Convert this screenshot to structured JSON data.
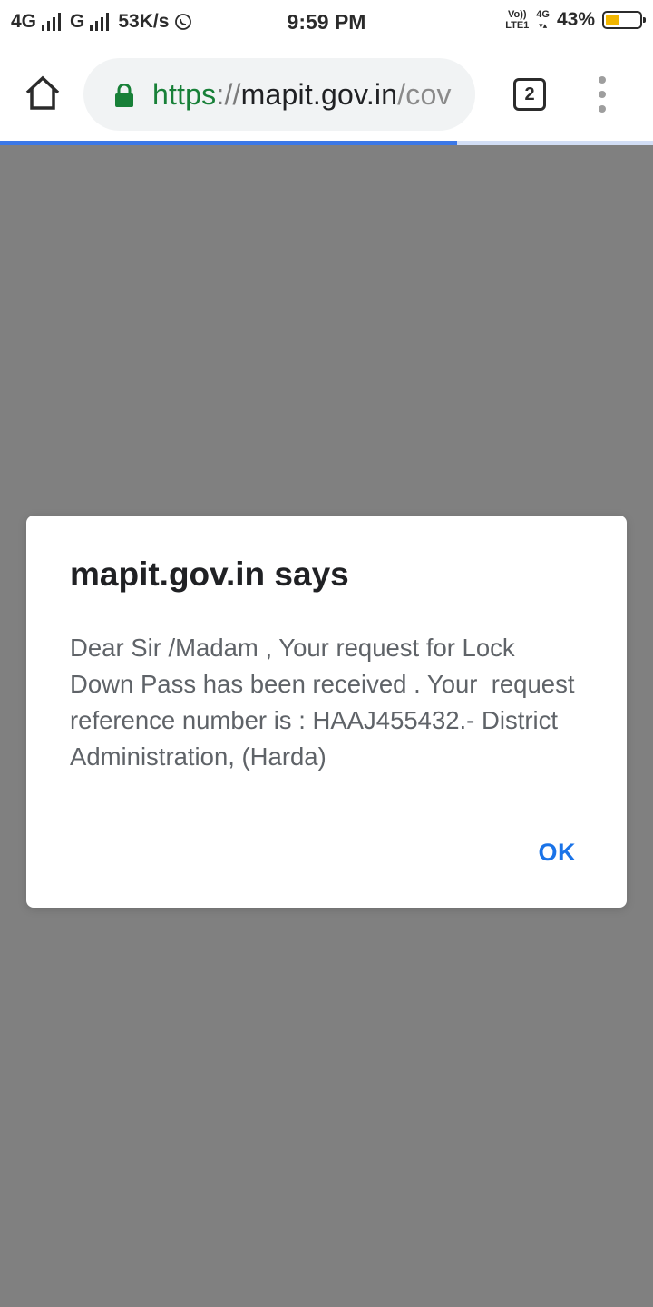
{
  "status_bar": {
    "network_1": "4G",
    "network_2": "G",
    "speed": "53K/s",
    "time": "9:59 PM",
    "volte_top": "Vo))",
    "volte_bottom": "LTE1",
    "lte_top": "4G",
    "battery_percent": "43%",
    "battery_level": 0.43,
    "battery_color": "#f2b600"
  },
  "toolbar": {
    "url_scheme": "https",
    "url_sep": "://",
    "url_host": "mapit.gov.in",
    "url_path": "/cov",
    "tab_count": "2",
    "secure_color": "#188038",
    "page_load_progress": 0.7
  },
  "dialog": {
    "title": "mapit.gov.in says",
    "message": "Dear Sir /Madam , Your request for Lock\nDown Pass has been received . Your  request\nreference number is : HAAJ455432.- District\nAdministration, (Harda)",
    "ok_label": "OK",
    "accent_color": "#1a73e8"
  },
  "icons": {
    "whatsapp": "whatsapp-icon",
    "home": "home-icon",
    "lock": "lock-icon",
    "menu": "more-vert-icon"
  }
}
